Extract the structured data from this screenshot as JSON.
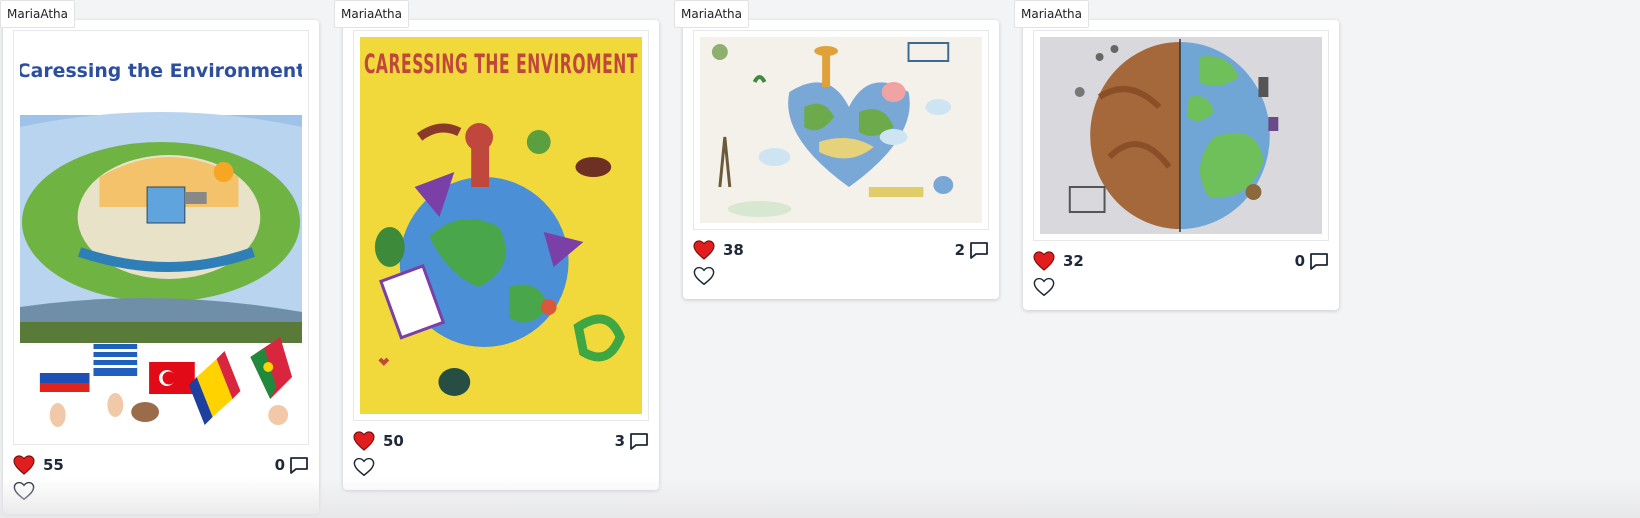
{
  "cards": [
    {
      "author": "MariaAtha",
      "artwork_title": "Caressing the Environment",
      "likes": "55",
      "comments": "0"
    },
    {
      "author": "MariaAtha",
      "artwork_title": "CARESSING THE ENVIROMENT",
      "likes": "50",
      "comments": "3"
    },
    {
      "author": "MariaAtha",
      "artwork_title": "",
      "likes": "38",
      "comments": "2"
    },
    {
      "author": "MariaAtha",
      "artwork_title": "",
      "likes": "32",
      "comments": "0"
    }
  ],
  "colors": {
    "liked_heart": "#e11d1d",
    "text": "#1f2937",
    "card_bg": "#ffffff",
    "page_bg": "#f3f4f6"
  },
  "icons": {
    "liked": "filled-heart-icon",
    "like_button": "outline-heart-icon",
    "comment": "speech-bubble-icon"
  }
}
